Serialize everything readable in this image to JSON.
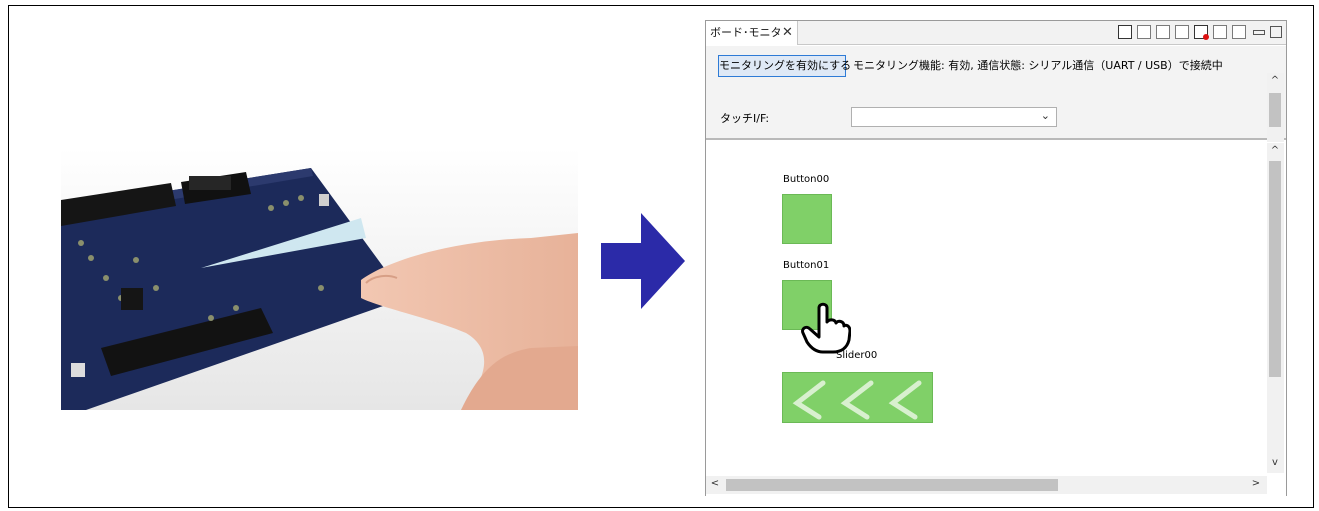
{
  "window": {
    "tab_title": "ボード･モニタ",
    "close_glyph": "✕",
    "toolbar_icons": [
      "board-view-icon",
      "export-icon",
      "import-icon",
      "settings-icon",
      "record-icon",
      "panel-icon",
      "grid-icon",
      "minimize-icon",
      "maximize-icon"
    ]
  },
  "top_pane": {
    "monitor_button": "モニタリングを有効にする",
    "status": "モニタリング機能: 有効, 通信状態: シリアル通信（UART / USB）で接続中",
    "touch_if_label": "タッチI/F:",
    "touch_if_value": "",
    "select_chevron": "⌄"
  },
  "canvas": {
    "items": [
      {
        "label": "Button00"
      },
      {
        "label": "Button01"
      },
      {
        "label": "Slider00"
      }
    ]
  },
  "scroll": {
    "up": "^",
    "down": "v",
    "left": "<",
    "right": ">"
  },
  "colors": {
    "widget_green": "#80d068",
    "arrow_blue": "#2b2aa8",
    "accent_blue": "#2e7bd6"
  }
}
